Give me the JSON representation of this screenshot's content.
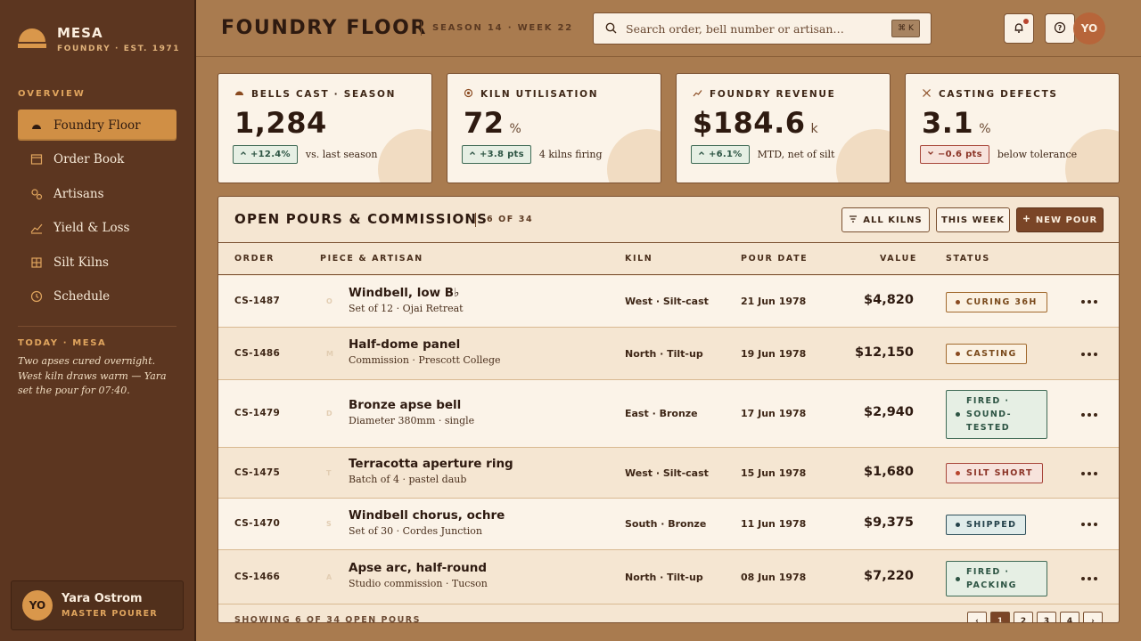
{
  "brand": {
    "name": "MESA",
    "sub": "FOUNDRY · EST. 1971"
  },
  "sidebar": {
    "section_label": "OVERVIEW",
    "items": [
      {
        "label": "Foundry Floor",
        "icon": "dome-icon",
        "active": true
      },
      {
        "label": "Order Book",
        "icon": "book-icon"
      },
      {
        "label": "Artisans",
        "icon": "people-icon"
      },
      {
        "label": "Yield & Loss",
        "icon": "trend-icon"
      },
      {
        "label": "Silt Kilns",
        "icon": "grid-icon"
      },
      {
        "label": "Schedule",
        "icon": "clock-icon"
      }
    ],
    "today_title": "TODAY · MESA",
    "today_note": "Two apses cured overnight. West kiln draws warm — Yara set the pour for 07:40."
  },
  "user": {
    "initials": "YO",
    "name": "Yara Ostrom",
    "role": "MASTER POURER"
  },
  "header": {
    "title": "FOUNDRY FLOOR",
    "season": "SEASON 14 · WEEK 22",
    "search_placeholder": "Search order, bell number or artisan…",
    "search_shortcut": "⌘ K",
    "avatar_initials": "YO"
  },
  "kpis": [
    {
      "label": "BELLS CAST · SEASON",
      "icon": "bell-icon",
      "value": "1,284",
      "unit": "",
      "delta": "+12.4%",
      "direction": "up",
      "note": "vs. last season"
    },
    {
      "label": "KILN UTILISATION",
      "icon": "kiln-icon",
      "value": "72",
      "unit": "%",
      "delta": "+3.8 pts",
      "direction": "up",
      "note": "4 kilns firing"
    },
    {
      "label": "FOUNDRY REVENUE",
      "icon": "trend-icon",
      "value": "$184.6",
      "unit": "k",
      "delta": "+6.1%",
      "direction": "up",
      "note": "MTD, net of silt"
    },
    {
      "label": "CASTING DEFECTS",
      "icon": "x-icon",
      "value": "3.1",
      "unit": "%",
      "delta": "−0.6 pts",
      "direction": "down",
      "note": "below tolerance"
    }
  ],
  "table": {
    "title": "OPEN POURS & COMMISSIONS",
    "count": "6 OF 34",
    "filter_all": "ALL KILNS",
    "filter_week": "THIS WEEK",
    "new_pour": "NEW POUR",
    "columns": {
      "order": "ORDER",
      "piece": "PIECE & ARTISAN",
      "kiln": "KILN",
      "date": "POUR DATE",
      "value": "VALUE",
      "status": "STATUS"
    },
    "rows": [
      {
        "order": "CS-1487",
        "initial": "O",
        "piece": "Windbell, low B♭",
        "sub": "Set of 12 · Ojai Retreat",
        "kiln": "West · Silt-cast",
        "date": "21 Jun 1978",
        "value": "$4,820",
        "status": "CURING 36H",
        "status_kind": "curing"
      },
      {
        "order": "CS-1486",
        "initial": "M",
        "piece": "Half-dome panel",
        "sub": "Commission · Prescott College",
        "kiln": "North · Tilt-up",
        "date": "19 Jun 1978",
        "value": "$12,150",
        "status": "CASTING",
        "status_kind": "curing"
      },
      {
        "order": "CS-1479",
        "initial": "D",
        "piece": "Bronze apse bell",
        "sub": "Diameter 380mm · single",
        "kiln": "East · Bronze",
        "date": "17 Jun 1978",
        "value": "$2,940",
        "status": "FIRED · SOUND-TESTED",
        "status_kind": "fired"
      },
      {
        "order": "CS-1475",
        "initial": "T",
        "piece": "Terracotta aperture ring",
        "sub": "Batch of 4 · pastel daub",
        "kiln": "West · Silt-cast",
        "date": "15 Jun 1978",
        "value": "$1,680",
        "status": "SILT SHORT",
        "status_kind": "silt"
      },
      {
        "order": "CS-1470",
        "initial": "S",
        "piece": "Windbell chorus, ochre",
        "sub": "Set of 30 · Cordes Junction",
        "kiln": "South · Bronze",
        "date": "11 Jun 1978",
        "value": "$9,375",
        "status": "SHIPPED",
        "status_kind": "shipped"
      },
      {
        "order": "CS-1466",
        "initial": "A",
        "piece": "Apse arc, half-round",
        "sub": "Studio commission · Tucson",
        "kiln": "North · Tilt-up",
        "date": "08 Jun 1978",
        "value": "$7,220",
        "status": "FIRED · PACKING",
        "status_kind": "fired"
      }
    ],
    "footer": "SHOWING 6 OF 34 OPEN POURS",
    "pages": [
      "‹",
      "1",
      "2",
      "3",
      "4",
      "›"
    ],
    "current_page": "1"
  },
  "colors": {
    "accent": "#d08f45",
    "sidebar": "#5c3620",
    "primary_button": "#7a4527",
    "background": "#a97b4f"
  }
}
